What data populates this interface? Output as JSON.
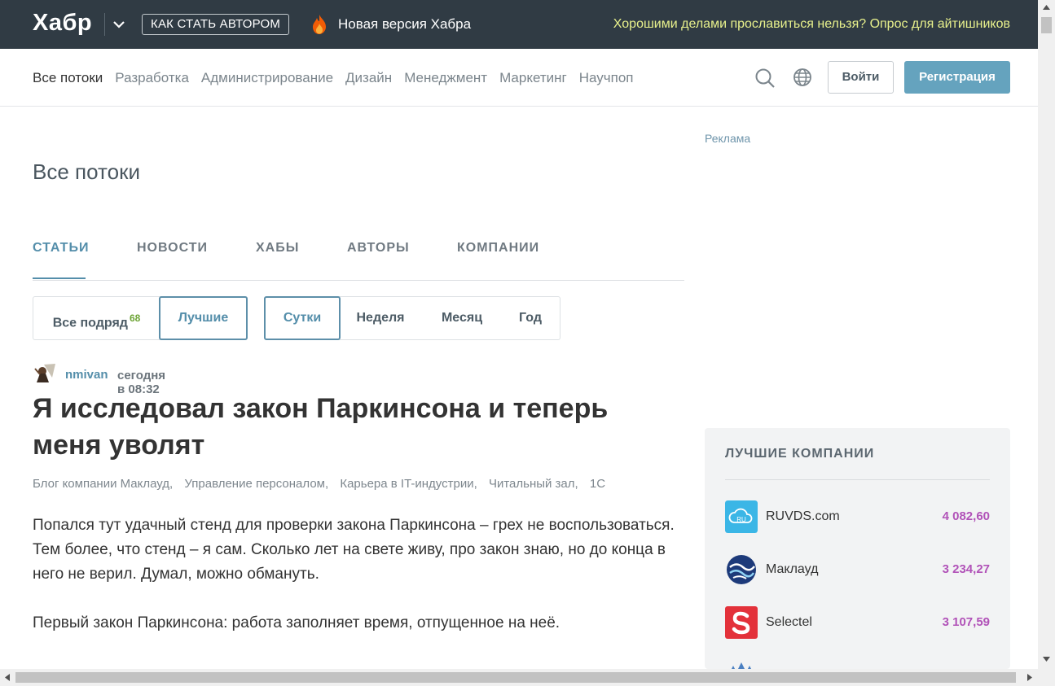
{
  "topbar": {
    "logo": "Хабр",
    "author_button": "КАК СТАТЬ АВТОРОМ",
    "new_version": "Новая версия Хабра",
    "promo": "Хорошими делами прославиться нельзя? Опрос для айтишников"
  },
  "nav": {
    "items": [
      "Все потоки",
      "Разработка",
      "Администрирование",
      "Дизайн",
      "Менеджмент",
      "Маркетинг",
      "Научпоп"
    ],
    "active_index": 0,
    "login": "Войти",
    "register": "Регистрация"
  },
  "main": {
    "page_title": "Все потоки",
    "tabs": [
      "СТАТЬИ",
      "НОВОСТИ",
      "ХАБЫ",
      "АВТОРЫ",
      "КОМПАНИИ"
    ],
    "active_tab": 0,
    "filters_a": {
      "all": "Все подряд",
      "all_count": "68",
      "best": "Лучшие"
    },
    "filters_b": [
      "Сутки",
      "Неделя",
      "Месяц",
      "Год"
    ],
    "article": {
      "author": "nmivan",
      "time": "сегодня в 08:32",
      "title": "Я исследовал закон Паркинсона и теперь меня уволят",
      "hubs": [
        "Блог компании Маклауд,",
        "Управление персоналом,",
        "Карьера в IT-индустрии,",
        "Читальный зал,",
        "1С"
      ],
      "paragraphs": [
        "Попался тут удачный стенд для проверки закона Паркинсона – грех не воспользоваться. Тем более, что стенд – я сам. Сколько лет на свете живу, про закон знаю, но до конца в него не верил. Думал, можно обмануть.",
        "Первый закон Паркинсона: работа заполняет время, отпущенное на неё."
      ]
    }
  },
  "sidebar": {
    "ad_label": "Реклама",
    "companies_title": "ЛУЧШИЕ КОМПАНИИ",
    "companies": [
      {
        "name": "RUVDS.com",
        "rating": "4 082,60",
        "logo_color": "#3bb6e6"
      },
      {
        "name": "Маклауд",
        "rating": "3 234,27",
        "logo_color": "#1d3a7a"
      },
      {
        "name": "Selectel",
        "rating": "3 107,59",
        "logo_color": "#e3313a"
      }
    ]
  },
  "colors": {
    "topbar_bg": "#303b44",
    "accent": "#548eaa",
    "register_bg": "#65a3be",
    "promo": "#e8f18c",
    "rating": "#b152b8",
    "badge": "#6da436"
  }
}
